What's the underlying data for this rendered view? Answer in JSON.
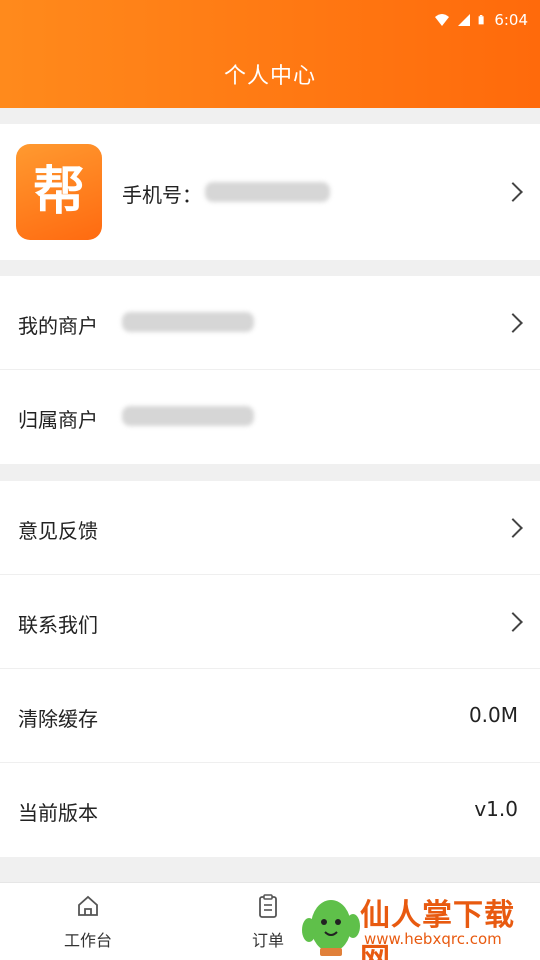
{
  "status": {
    "time": "6:04"
  },
  "header": {
    "title": "个人中心"
  },
  "profile": {
    "logo_char": "帮",
    "phone_label": "手机号："
  },
  "merchant": {
    "my_merchant": "我的商户",
    "owner_merchant": "归属商户"
  },
  "settings": {
    "feedback": "意见反馈",
    "contact": "联系我们",
    "clear_cache": "清除缓存",
    "cache_size": "0.0M",
    "version_label": "当前版本",
    "version_value": "v1.0"
  },
  "tabs": [
    {
      "label": "工作台",
      "icon": "home-icon"
    },
    {
      "label": "订单",
      "icon": "clipboard-icon"
    }
  ],
  "watermark": {
    "text": "仙人掌下载网",
    "url": "www.hebxqrc.com"
  },
  "colors": {
    "accent": "#ff7410"
  }
}
